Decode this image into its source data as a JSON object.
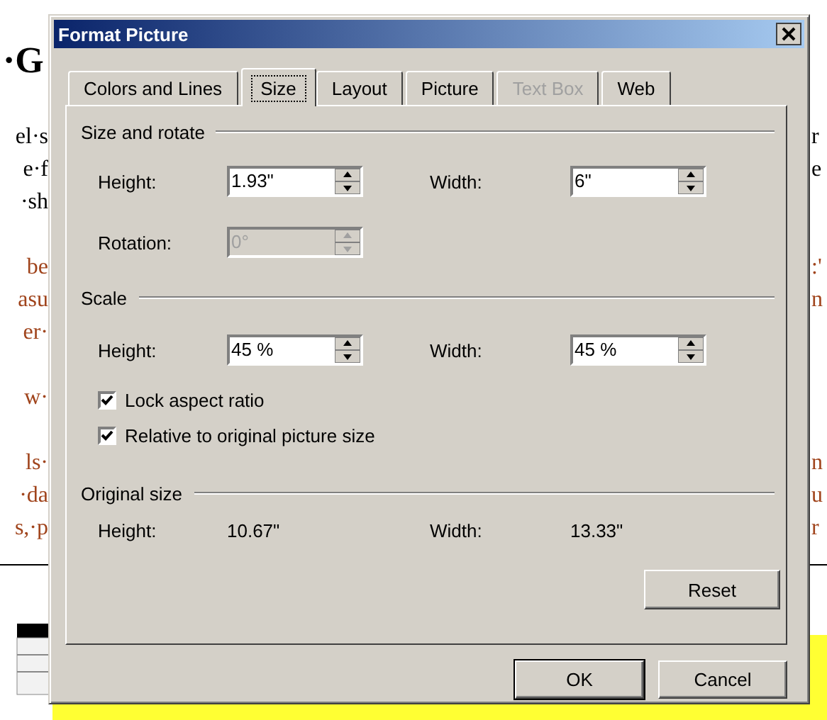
{
  "document": {
    "heading": "·G",
    "left_lines": [
      {
        "text": "el·s",
        "color": "#000000"
      },
      {
        "text": "e·f",
        "color": "#000000"
      },
      {
        "text": "·sh",
        "color": "#000000"
      },
      {
        "text": "be",
        "color": "#a0441c"
      },
      {
        "text": "asu",
        "color": "#a0441c"
      },
      {
        "text": "er·",
        "color": "#a0441c"
      },
      {
        "text": "w·",
        "color": "#a0441c"
      },
      {
        "text": "ls·",
        "color": "#a0441c"
      },
      {
        "text": "·da",
        "color": "#a0441c"
      },
      {
        "text": "s,·p",
        "color": "#a0441c"
      }
    ],
    "right_lines": [
      {
        "text": "r",
        "color": "#000000"
      },
      {
        "text": "e",
        "color": "#000000"
      },
      {
        "text": ":'",
        "color": "#a0441c"
      },
      {
        "text": "n",
        "color": "#a0441c"
      },
      {
        "text": "n",
        "color": "#a0441c"
      },
      {
        "text": "u",
        "color": "#a0441c"
      },
      {
        "text": "r",
        "color": "#a0441c"
      }
    ]
  },
  "dialog": {
    "title": "Format Picture",
    "tabs": [
      {
        "label": "Colors and Lines",
        "selected": false,
        "disabled": false
      },
      {
        "label": "Size",
        "selected": true,
        "disabled": false
      },
      {
        "label": "Layout",
        "selected": false,
        "disabled": false
      },
      {
        "label": "Picture",
        "selected": false,
        "disabled": false
      },
      {
        "label": "Text Box",
        "selected": false,
        "disabled": true
      },
      {
        "label": "Web",
        "selected": false,
        "disabled": false
      }
    ],
    "size_and_rotate": {
      "heading": "Size and rotate",
      "fields": [
        {
          "label": "Height:",
          "value": "1.93\"",
          "disabled": false
        },
        {
          "label": "Width:",
          "value": "6\"",
          "disabled": false
        },
        {
          "label": "Rotation:",
          "value": "0°",
          "disabled": true
        }
      ]
    },
    "scale": {
      "heading": "Scale",
      "fields": [
        {
          "label": "Height:",
          "value": "45 %",
          "disabled": false
        },
        {
          "label": "Width:",
          "value": "45 %",
          "disabled": false
        }
      ],
      "checkboxes": [
        {
          "label": "Lock aspect ratio",
          "checked": true
        },
        {
          "label": "Relative to original picture size",
          "checked": true
        }
      ]
    },
    "original_size": {
      "heading": "Original size",
      "height_label": "Height:",
      "height_value": "10.67\"",
      "width_label": "Width:",
      "width_value": "13.33\""
    },
    "reset_button": "Reset",
    "buttons": [
      "OK",
      "Cancel"
    ]
  }
}
